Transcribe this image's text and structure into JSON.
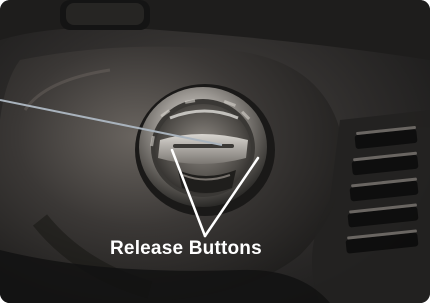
{
  "annotation": {
    "label": "Release Buttons",
    "label_color": "#ffffff",
    "line_color": "#ffffff",
    "pointer_color": "#a9b3bd"
  },
  "scene": {
    "subject": "ignition-key-cylinder",
    "background_color": "#2b2b2b"
  }
}
